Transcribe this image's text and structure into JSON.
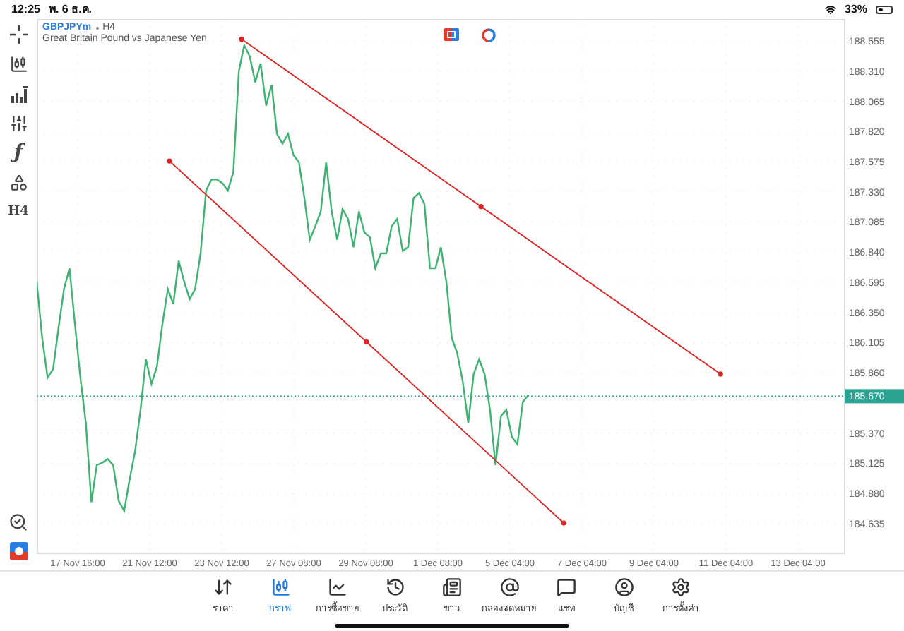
{
  "status_bar": {
    "time": "12:25",
    "date": "พ. 6 ธ.ค.",
    "battery": "33%"
  },
  "left_toolbar": [
    {
      "kind": "crosshair"
    },
    {
      "kind": "candles"
    },
    {
      "kind": "bars"
    },
    {
      "kind": "sliders"
    },
    {
      "kind": "glyph",
      "label": "ƒ"
    },
    {
      "kind": "shapes"
    },
    {
      "kind": "glyph",
      "label": "H4"
    }
  ],
  "left_toolbar_bottom": [
    {
      "kind": "zoom"
    },
    {
      "kind": "logo"
    }
  ],
  "chart_header": {
    "timeframe": "H4",
    "description": "Great Britain Pound vs Japanese Yen"
  },
  "chart_data": {
    "type": "line",
    "grid": true,
    "ylim": [
      184.394,
      188.727
    ],
    "yticks": [
      {
        "value": 188.555,
        "label": "188.555"
      },
      {
        "value": 188.31,
        "label": "188.310"
      },
      {
        "value": 188.065,
        "label": "188.065"
      },
      {
        "value": 187.82,
        "label": "187.820"
      },
      {
        "value": 187.575,
        "label": "187.575"
      },
      {
        "value": 187.33,
        "label": "187.330"
      },
      {
        "value": 187.085,
        "label": "187.085"
      },
      {
        "value": 186.84,
        "label": "186.840"
      },
      {
        "value": 186.595,
        "label": "186.595"
      },
      {
        "value": 186.35,
        "label": "186.350"
      },
      {
        "value": 186.105,
        "label": "186.105"
      },
      {
        "value": 185.86,
        "label": "185.860"
      },
      {
        "value": 185.37,
        "label": "185.370"
      },
      {
        "value": 185.125,
        "label": "185.125"
      },
      {
        "value": 184.88,
        "label": "184.880"
      },
      {
        "value": 184.635,
        "label": "184.635"
      }
    ],
    "series": [
      {
        "name": "GBPJPYm",
        "color": "#3cb371",
        "values": [
          186.6,
          186.14,
          185.82,
          185.89,
          186.23,
          186.54,
          186.71,
          186.25,
          185.82,
          185.45,
          184.81,
          185.11,
          185.13,
          185.16,
          185.11,
          184.82,
          184.74,
          184.99,
          185.22,
          185.56,
          185.97,
          185.77,
          185.91,
          186.25,
          186.54,
          186.42,
          186.77,
          186.6,
          186.46,
          186.54,
          186.83,
          187.34,
          187.43,
          187.43,
          187.4,
          187.34,
          187.49,
          188.31,
          188.52,
          188.43,
          188.22,
          188.37,
          188.03,
          188.2,
          187.8,
          187.72,
          187.8,
          187.63,
          187.57,
          187.28,
          186.94,
          187.05,
          187.17,
          187.57,
          187.17,
          186.94,
          187.19,
          187.11,
          186.88,
          187.17,
          187.0,
          186.96,
          186.71,
          186.83,
          186.83,
          187.05,
          187.11,
          186.85,
          186.88,
          187.28,
          187.32,
          187.23,
          186.71,
          186.71,
          186.88,
          186.6,
          186.14,
          186.02,
          185.79,
          185.45,
          185.85,
          185.97,
          185.85,
          185.56,
          185.11,
          185.51,
          185.56,
          185.34,
          185.28,
          185.62,
          185.68
        ]
      }
    ],
    "ref_lines": [
      {
        "axis": "y",
        "value": 185.67,
        "label": "185.670",
        "color": "#2aa392"
      }
    ]
  },
  "time_axis": [
    "17 Nov 16:00",
    "21 Nov 12:00",
    "23 Nov 12:00",
    "27 Nov 08:00",
    "29 Nov 08:00",
    "1 Dec 08:00",
    "5 Dec 04:00",
    "7 Dec 04:00",
    "9 Dec 04:00",
    "11 Dec 04:00",
    "13 Dec 04:00"
  ],
  "trend_lines": [
    {
      "color": "#e02020"
    },
    {
      "color": "#e02020"
    }
  ],
  "tabs": [
    {
      "label": "ราคา",
      "selected": false
    },
    {
      "label": "กราฟ",
      "selected": true
    },
    {
      "label": "การซื้อขาย",
      "selected": false
    },
    {
      "label": "ประวัติ",
      "selected": false
    },
    {
      "label": "ข่าว",
      "selected": false
    },
    {
      "label": "กล่องจดหมาย",
      "selected": false
    },
    {
      "label": "แชท",
      "selected": false
    },
    {
      "label": "บัญชี",
      "selected": false
    },
    {
      "label": "การตั้งค่า",
      "selected": false
    }
  ]
}
